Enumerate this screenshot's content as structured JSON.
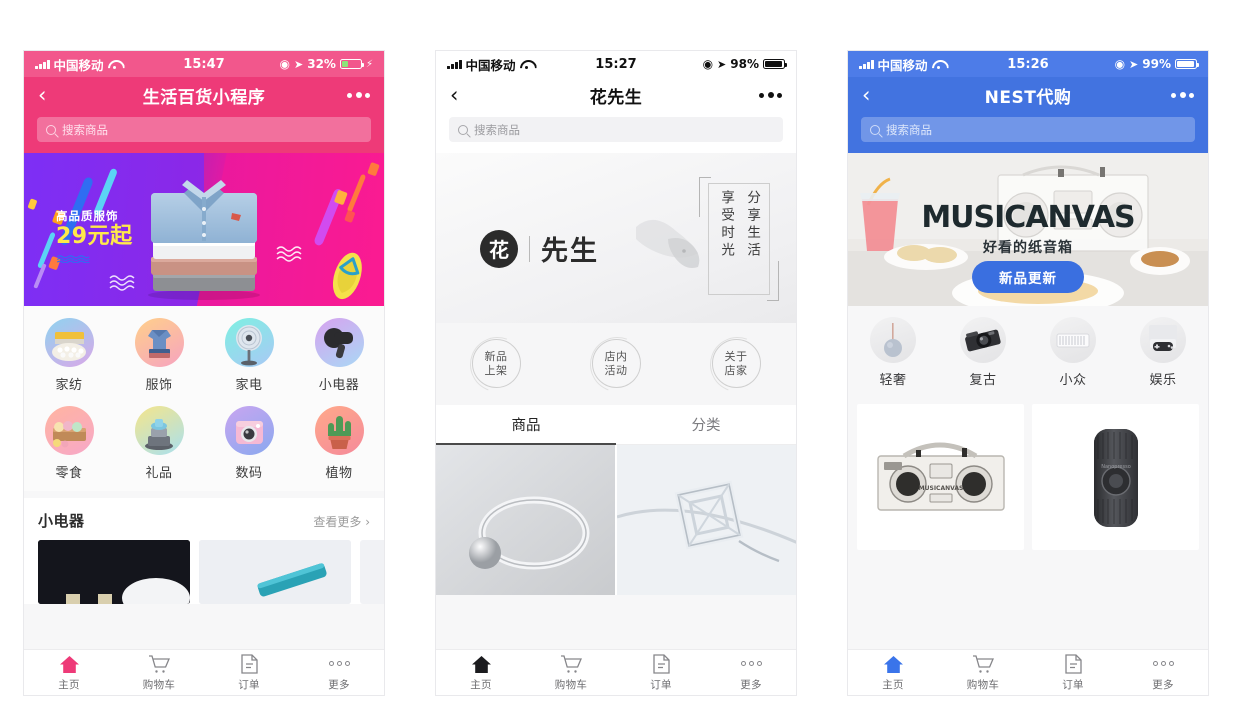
{
  "phones": [
    {
      "id": "phone-1",
      "theme": "#ee3a78",
      "status": {
        "carrier": "中国移动",
        "time": "15:47",
        "battery": "32%"
      },
      "nav": {
        "back": "‹",
        "title": "生活百货小程序",
        "more": "more-dots"
      },
      "search": {
        "placeholder": "搜索商品",
        "icon": "search-icon"
      },
      "banner": {
        "headline": "高品质服饰",
        "price": "29元起",
        "image": "stacked-shirts"
      },
      "categories": [
        {
          "label": "家纺",
          "icon": "bedding"
        },
        {
          "label": "服饰",
          "icon": "clothing"
        },
        {
          "label": "家电",
          "icon": "fan"
        },
        {
          "label": "小电器",
          "icon": "hairdryer"
        },
        {
          "label": "零食",
          "icon": "snacks"
        },
        {
          "label": "礼品",
          "icon": "gift"
        },
        {
          "label": "数码",
          "icon": "camera"
        },
        {
          "label": "植物",
          "icon": "cactus"
        }
      ],
      "section": {
        "title": "小电器",
        "more": "查看更多",
        "chevron": "›"
      },
      "tabbar": [
        {
          "label": "主页",
          "icon": "home-icon",
          "active": true
        },
        {
          "label": "购物车",
          "icon": "cart-icon",
          "active": false
        },
        {
          "label": "订单",
          "icon": "order-icon",
          "active": false
        },
        {
          "label": "更多",
          "icon": "more-icon",
          "active": false
        }
      ]
    },
    {
      "id": "phone-2",
      "theme": "#ffffff",
      "status": {
        "carrier": "中国移动",
        "time": "15:27",
        "battery": "98%"
      },
      "nav": {
        "back": "‹",
        "title": "花先生",
        "more": "more-dots"
      },
      "search": {
        "placeholder": "搜索商品",
        "icon": "search-icon"
      },
      "banner": {
        "logo_char": "花",
        "brand": "先生",
        "poem_right": "分享生活",
        "poem_left": "享受时光",
        "image": "bird-silhouette"
      },
      "circles": [
        {
          "line1": "新品",
          "line2": "上架"
        },
        {
          "line1": "店内",
          "line2": "活动"
        },
        {
          "line1": "关于",
          "line2": "店家"
        }
      ],
      "tabs": [
        {
          "label": "商品",
          "active": true
        },
        {
          "label": "分类",
          "active": false
        }
      ],
      "products": [
        {
          "name": "silver-ball-ring"
        },
        {
          "name": "cube-pendant-necklace"
        }
      ],
      "tabbar": [
        {
          "label": "主页",
          "icon": "home-icon",
          "active": true
        },
        {
          "label": "购物车",
          "icon": "cart-icon",
          "active": false
        },
        {
          "label": "订单",
          "icon": "order-icon",
          "active": false
        },
        {
          "label": "更多",
          "icon": "more-icon",
          "active": false
        }
      ]
    },
    {
      "id": "phone-3",
      "theme": "#4273e0",
      "status": {
        "carrier": "中国移动",
        "time": "15:26",
        "battery": "99%"
      },
      "nav": {
        "back": "‹",
        "title": "NEST代购",
        "more": "more-dots"
      },
      "search": {
        "placeholder": "搜索商品",
        "icon": "search-icon"
      },
      "banner": {
        "wordmark": "MUSICANVAS",
        "subtitle": "好看的纸音箱",
        "button": "新品更新",
        "image": "paper-boombox-table"
      },
      "categories": [
        {
          "label": "轻奢",
          "icon": "pendant"
        },
        {
          "label": "复古",
          "icon": "retro-camera"
        },
        {
          "label": "小众",
          "icon": "radiator"
        },
        {
          "label": "娱乐",
          "icon": "game-controller"
        }
      ],
      "products": [
        {
          "name": "musicanvas-paper-boombox"
        },
        {
          "name": "portable-espresso-maker"
        }
      ],
      "tabbar": [
        {
          "label": "主页",
          "icon": "home-icon",
          "active": true
        },
        {
          "label": "购物车",
          "icon": "cart-icon",
          "active": false
        },
        {
          "label": "订单",
          "icon": "order-icon",
          "active": false
        },
        {
          "label": "更多",
          "icon": "more-icon",
          "active": false
        }
      ]
    }
  ]
}
